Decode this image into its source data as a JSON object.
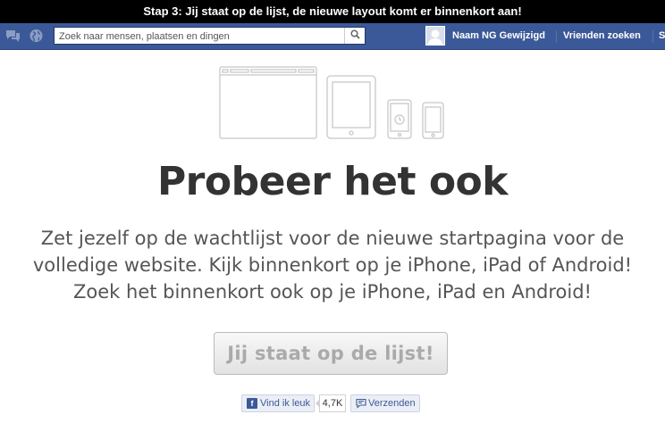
{
  "banner": {
    "text": "Stap 3: Jij staat op de lijst, de nieuwe layout komt er binnenkort aan!"
  },
  "fbbar": {
    "search_placeholder": "Zoek naar mensen, plaatsen en dingen",
    "user_name": "Naam NG Gewijzigd",
    "find_friends": "Vrienden zoeken",
    "truncated_link": "S"
  },
  "icons": {
    "messages": "messages-icon",
    "globe": "globe-icon",
    "search": "search-icon",
    "avatar": "avatar-silhouette-icon",
    "facebook_f": "facebook-f-icon",
    "send": "speech-bubble-icon"
  },
  "main": {
    "headline": "Probeer het ook",
    "lines": [
      "Zet jezelf op de wachtlijst voor de nieuwe startpagina voor de",
      "volledige website. Kijk binnenkort op je iPhone, iPad of Android!",
      "Zoek het binnenkort ook op je iPhone, iPad en Android!"
    ],
    "button_label": "Jij staat op de lijst!"
  },
  "social": {
    "like_label": "Vind ik leuk",
    "like_count": "4,7K",
    "send_label": "Verzenden"
  },
  "colors": {
    "fb_blue": "#3b5998",
    "text_dark": "#333333",
    "text_gray": "#555555"
  }
}
